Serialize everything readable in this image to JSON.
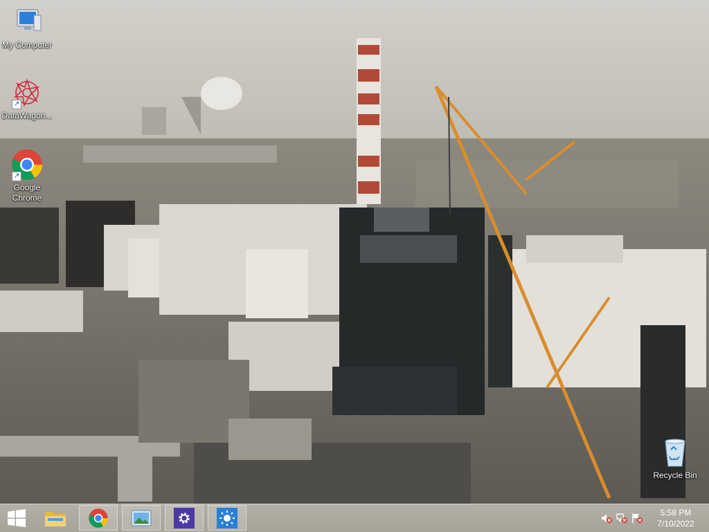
{
  "desktop": {
    "icons": [
      {
        "label": "My Computer",
        "icon": "computer-icon"
      },
      {
        "label": "DataWagon...",
        "icon": "datawagon-icon"
      },
      {
        "label": "Google Chrome",
        "icon": "chrome-icon"
      },
      {
        "label": "Recycle Bin",
        "icon": "recycle-bin-icon"
      }
    ]
  },
  "taskbar": {
    "start": {
      "icon": "windows-logo-icon"
    },
    "apps": [
      {
        "icon": "file-explorer-icon"
      },
      {
        "icon": "chrome-icon"
      },
      {
        "icon": "image-viewer-icon"
      },
      {
        "icon": "settings-gear-icon"
      },
      {
        "icon": "brightness-icon"
      }
    ],
    "tray": {
      "icons": [
        "speaker-muted-icon",
        "network-icon",
        "action-center-flag-icon"
      ],
      "time": "5:58 PM",
      "date": "7/10/2022"
    }
  },
  "colors": {
    "taskbar": "#a9a59c",
    "settings_tile": "#4b3aa6",
    "brightness_tile": "#2a80d6"
  }
}
